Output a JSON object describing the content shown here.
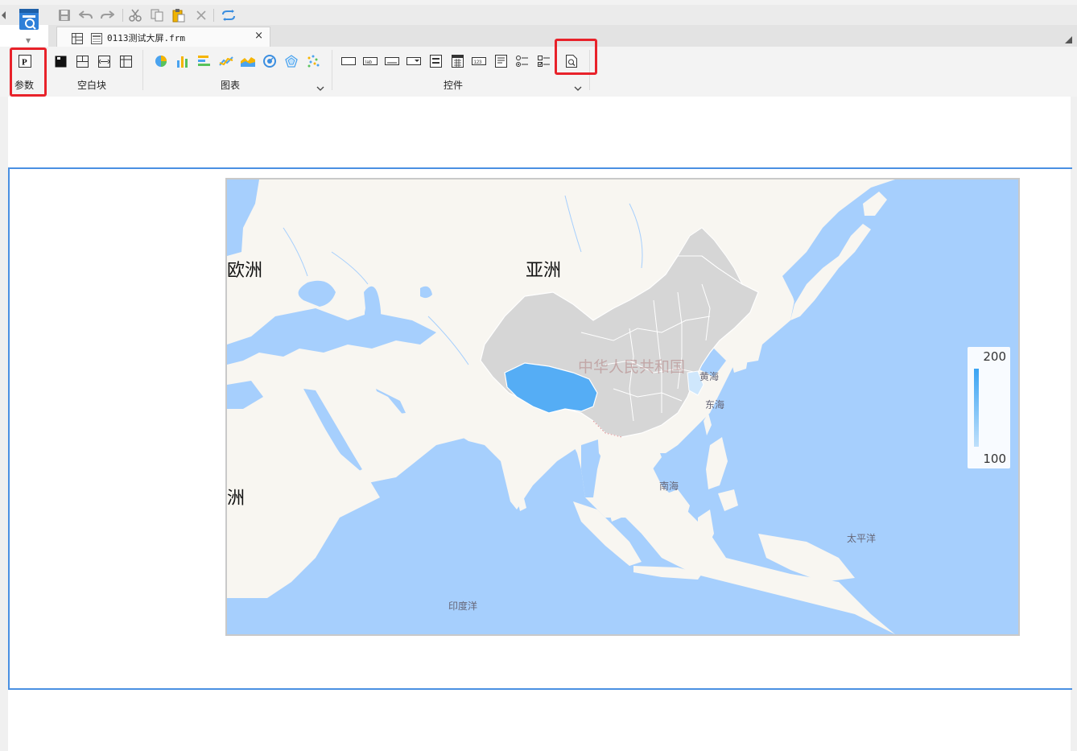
{
  "toolbar": {
    "quick_icons": [
      "save-icon",
      "undo-icon",
      "redo-icon",
      "cut-icon",
      "copy-icon",
      "paste-icon",
      "delete-icon",
      "refresh-icon"
    ]
  },
  "tab": {
    "label": "0113测试大屏.frm",
    "close": "×"
  },
  "ribbon": {
    "groups": [
      {
        "name": "param",
        "label": "参数"
      },
      {
        "name": "blank-block",
        "label": "空白块"
      },
      {
        "name": "chart",
        "label": "图表"
      },
      {
        "name": "widget",
        "label": "控件"
      }
    ]
  },
  "map": {
    "continents": {
      "europe": "欧洲",
      "asia": "亚洲",
      "africa_partial": "洲"
    },
    "country": "中华人民共和国",
    "seas": {
      "yellow_sea": "黄海",
      "east_sea": "东海",
      "south_sea": "南海",
      "pacific": "太平洋",
      "indian_ocean": "印度洋"
    },
    "visual_map": {
      "max": "200",
      "min": "100"
    },
    "colors": {
      "land": "#f8f6f1",
      "water": "#a6cffd",
      "china_region": "#d6d6d6",
      "highlight_high": "#55adf5",
      "highlight_low": "#cfe7fc"
    }
  },
  "colors": {
    "accent_blue": "#4a90e2",
    "highlight_red": "#e8222a"
  }
}
